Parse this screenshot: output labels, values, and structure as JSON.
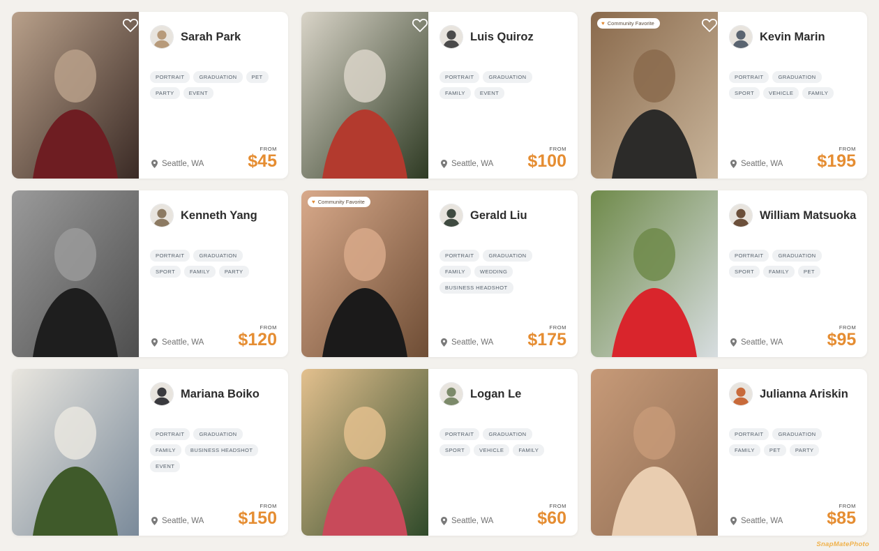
{
  "watermark": "SnapMatePhoto",
  "location_label": "Seattle, WA",
  "from_label": "FROM",
  "cards": [
    {
      "name": "Sarah Park",
      "tags": [
        "PORTRAIT",
        "GRADUATION",
        "PET",
        "PARTY",
        "EVENT"
      ],
      "price": "$45",
      "community_favorite": false,
      "favorite_heart": true,
      "photo_colors": [
        "#6e1d22",
        "#b8a08a",
        "#3a2a25"
      ],
      "avatar_color": "#b79a7a"
    },
    {
      "name": "Luis Quiroz",
      "tags": [
        "PORTRAIT",
        "GRADUATION",
        "FAMILY",
        "EVENT"
      ],
      "price": "$100",
      "community_favorite": false,
      "favorite_heart": true,
      "photo_colors": [
        "#b33a2e",
        "#d9d4c8",
        "#2e3a23"
      ],
      "avatar_color": "#4a4a4a"
    },
    {
      "name": "Kevin Marin",
      "tags": [
        "PORTRAIT",
        "GRADUATION",
        "SPORT",
        "VEHICLE",
        "FAMILY"
      ],
      "price": "$195",
      "community_favorite": true,
      "favorite_heart": true,
      "photo_colors": [
        "#2c2b29",
        "#8a6a4c",
        "#c8b49a"
      ],
      "avatar_color": "#5a6470"
    },
    {
      "name": "Kenneth Yang",
      "tags": [
        "PORTRAIT",
        "GRADUATION",
        "SPORT",
        "FAMILY",
        "PARTY"
      ],
      "price": "$120",
      "community_favorite": false,
      "favorite_heart": false,
      "photo_colors": [
        "#1e1e1e",
        "#9a9a9a",
        "#4e4e4e"
      ],
      "avatar_color": "#8c7a62"
    },
    {
      "name": "Gerald Liu",
      "tags": [
        "PORTRAIT",
        "GRADUATION",
        "FAMILY",
        "WEDDING",
        "BUSINESS HEADSHOT"
      ],
      "price": "$175",
      "community_favorite": true,
      "favorite_heart": false,
      "photo_colors": [
        "#1b1a1a",
        "#d8a98a",
        "#6e4d35"
      ],
      "avatar_color": "#3f4a40"
    },
    {
      "name": "William Matsuoka",
      "tags": [
        "PORTRAIT",
        "GRADUATION",
        "SPORT",
        "FAMILY",
        "PET"
      ],
      "price": "$95",
      "community_favorite": false,
      "favorite_heart": false,
      "photo_colors": [
        "#d9252c",
        "#6f8a4a",
        "#d7dde0"
      ],
      "avatar_color": "#6b4f3a"
    },
    {
      "name": "Mariana Boiko",
      "tags": [
        "PORTRAIT",
        "GRADUATION",
        "FAMILY",
        "BUSINESS HEADSHOT",
        "EVENT"
      ],
      "price": "$150",
      "community_favorite": false,
      "favorite_heart": false,
      "photo_colors": [
        "#3f5a2a",
        "#e9e6df",
        "#7a8a9a"
      ],
      "avatar_color": "#3a3a3e"
    },
    {
      "name": "Logan Le",
      "tags": [
        "PORTRAIT",
        "GRADUATION",
        "SPORT",
        "VEHICLE",
        "FAMILY"
      ],
      "price": "$60",
      "community_favorite": false,
      "favorite_heart": false,
      "photo_colors": [
        "#c84a5a",
        "#e3c08e",
        "#2f4a2a"
      ],
      "avatar_color": "#7c8a6a"
    },
    {
      "name": "Julianna Ariskin",
      "tags": [
        "PORTRAIT",
        "GRADUATION",
        "FAMILY",
        "PET",
        "PARTY"
      ],
      "price": "$85",
      "community_favorite": false,
      "favorite_heart": false,
      "photo_colors": [
        "#e9cdb0",
        "#c79a78",
        "#8c6b52"
      ],
      "avatar_color": "#c86a3a"
    }
  ],
  "community_favorite_label": "Community Favorite",
  "icons": {
    "heart": "heart-icon",
    "pin": "location-pin-icon",
    "badge_heart": "heart-icon"
  }
}
